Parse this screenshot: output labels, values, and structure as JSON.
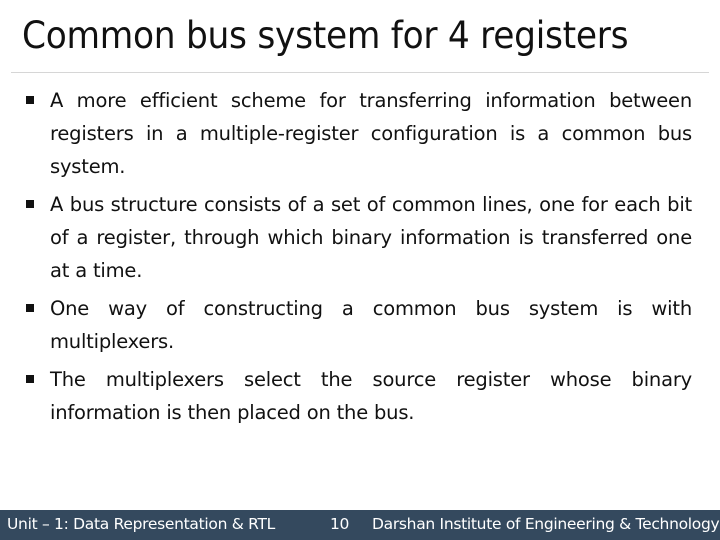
{
  "slide": {
    "title": "Common bus system for 4 registers",
    "bullets": [
      "A more efficient scheme for transferring information between registers in a multiple-register configuration is a common bus system.",
      "A bus structure consists of a set of common lines, one for each bit of a register, through which binary information is transferred one at a time.",
      "One way of constructing a common bus system is with multiplexers.",
      "The multiplexers select the source register whose binary information is then placed on the bus."
    ]
  },
  "footer": {
    "unit": "Unit – 1: Data Representation & RTL",
    "page_number": "10",
    "institute": "Darshan Institute of Engineering & Technology",
    "background_color": "#34495e"
  }
}
